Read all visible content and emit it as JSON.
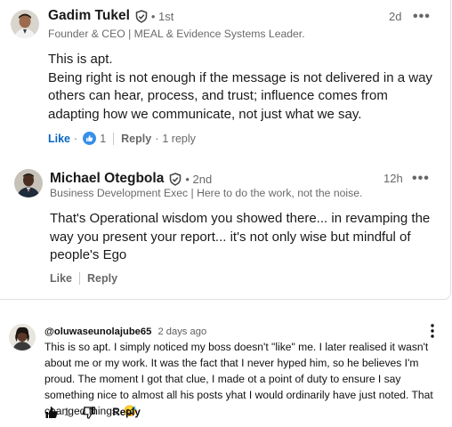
{
  "linkedin": {
    "comment1": {
      "author": "Gadim Tukel",
      "verified_icon": "shield-check-icon",
      "degree": "• 1st",
      "headline": "Founder & CEO | MEAL & Evidence Systems Leader.",
      "time": "2d",
      "more_icon": "•••",
      "body": [
        "This is apt.",
        "Being right is not enough if the message is not delivered in a way others can hear, process, and trust; influence comes from adapting how we communicate, not just what we say."
      ],
      "like_label": "Like",
      "like_sep": "·",
      "reaction_icon": "thumbs-up-reaction-icon",
      "reaction_count": "1",
      "reply_label": "Reply",
      "reply_sep": "·",
      "reply_count": "1 reply"
    },
    "comment2": {
      "author": "Michael Otegbola",
      "verified_icon": "shield-check-icon",
      "degree": "• 2nd",
      "headline": "Business Development Exec | Here to do the work, not the noise.",
      "time": "12h",
      "more_icon": "•••",
      "body": "That's Operational wisdom you showed there... in revamping the way you present your report... it's not only wise but mindful of people's Ego",
      "like_label": "Like",
      "reply_label": "Reply"
    }
  },
  "youtube": {
    "handle": "@oluwaseunolajube65",
    "date": "2 days ago",
    "text": "This is so apt. I simply noticed my boss doesn't \"like\" me. I later realised it wasn't about me or my work. It was the fact that I never hyped him, so he believes I'm proud. The moment I got that clue, I made ot a point of duty to ensure I say something nice to almost all his posts yhat I would ordinarily have just noted. That changed things. 😅",
    "like_count": "1",
    "reply_label": "Reply",
    "icons": {
      "like": "thumbs-up-icon",
      "dislike": "thumbs-down-icon",
      "more": "vertical-dots-icon"
    }
  },
  "colors": {
    "linkedin_blue": "#0a66c2",
    "text_primary": "#191919",
    "text_secondary": "#666666",
    "divider": "#e0dfdc"
  }
}
